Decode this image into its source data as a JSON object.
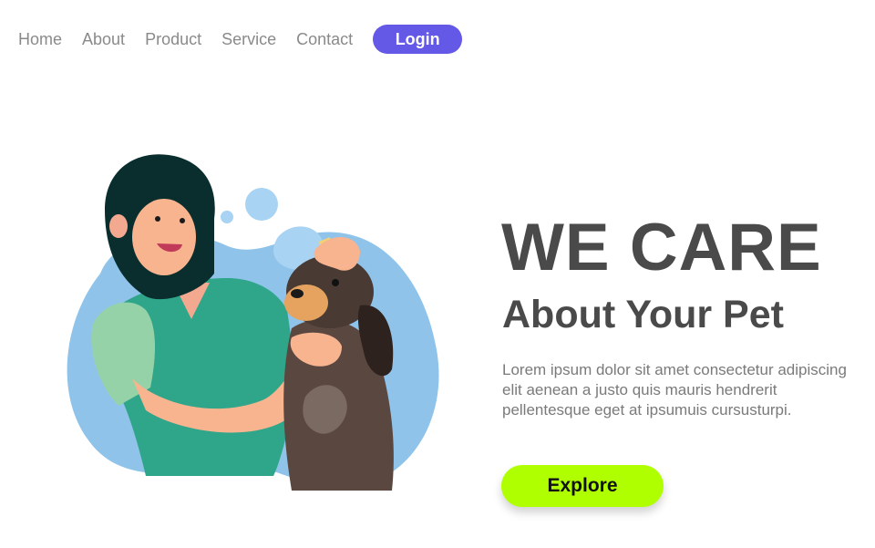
{
  "nav": {
    "links": [
      "Home",
      "About",
      "Product",
      "Service",
      "Contact"
    ],
    "login_label": "Login"
  },
  "hero": {
    "title": "WE CARE",
    "subtitle": "About Your Pet",
    "paragraph": "Lorem ipsum dolor sit amet consectetur adipiscing elit aenean a justo quis mauris hendrerit pellentesque eget at ipsumuis cursusturpi.",
    "explore_label": "Explore"
  },
  "colors": {
    "accent": "#6458e6",
    "explore": "#b0ff00",
    "text": "#4a4a4a",
    "blob": "#8fc3ea"
  }
}
